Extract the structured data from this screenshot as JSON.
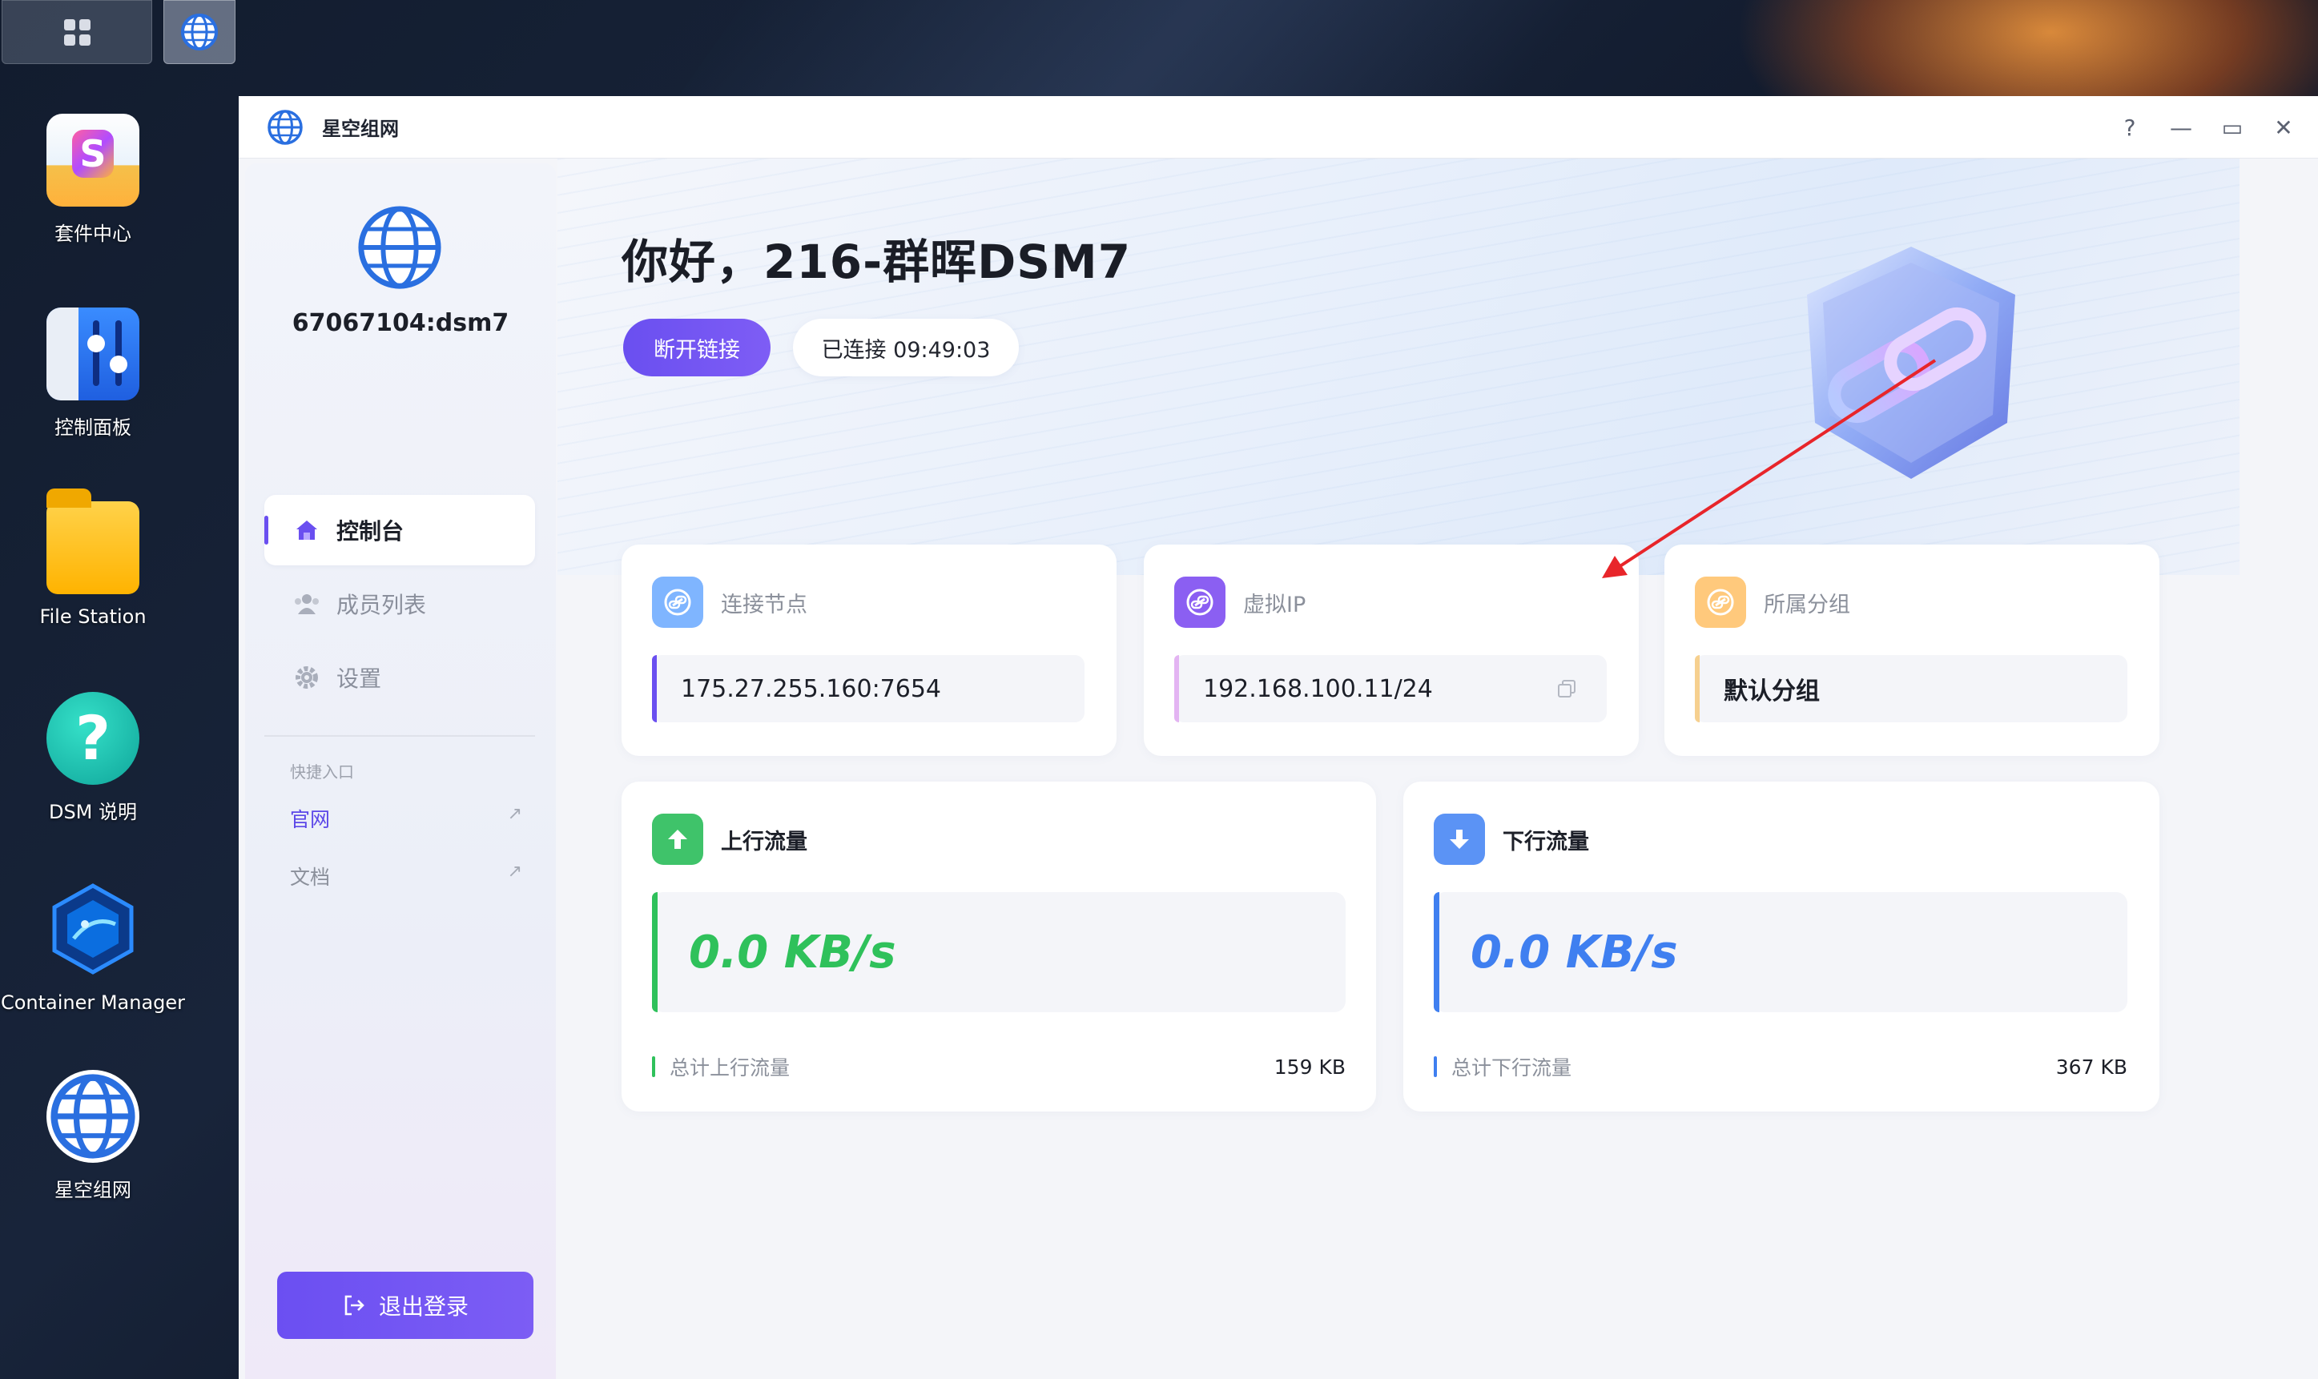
{
  "desktop": {
    "icons": [
      {
        "label": "套件中心"
      },
      {
        "label": "控制面板"
      },
      {
        "label": "File Station"
      },
      {
        "label": "DSM 说明"
      },
      {
        "label": "Container Manager"
      },
      {
        "label": "星空组网"
      }
    ]
  },
  "window": {
    "title": "星空组网",
    "controls": {
      "help": "?",
      "minimize": "—",
      "maximize": "▭",
      "close": "✕"
    }
  },
  "sidebar": {
    "account": "67067104:dsm7",
    "nav": [
      {
        "label": "控制台",
        "icon": "home-icon",
        "active": true
      },
      {
        "label": "成员列表",
        "icon": "members-icon",
        "active": false
      },
      {
        "label": "设置",
        "icon": "gear-icon",
        "active": false
      }
    ],
    "quick_title": "快捷入口",
    "quick_links": [
      {
        "label": "官网",
        "arrow": "↗",
        "color": "#5b47e8"
      },
      {
        "label": "文档",
        "arrow": "↗",
        "color": "#8b909b"
      }
    ],
    "logout_label": "退出登录"
  },
  "main": {
    "greeting": "你好，216-群晖DSM7",
    "disconnect_label": "断开链接",
    "connected_status": "已连接 09:49:03",
    "cards": {
      "node": {
        "label": "连接节点",
        "value": "175.27.255.160:7654",
        "accent": "#6a4ff0"
      },
      "vip": {
        "label": "虚拟IP",
        "value": "192.168.100.11/24",
        "accent": "#e3b4f2"
      },
      "group": {
        "label": "所属分组",
        "value": "默认分组",
        "accent": "#f6d08f"
      }
    },
    "upload": {
      "label": "上行流量",
      "speed": "0.0 KB/s",
      "total_label": "总计上行流量",
      "total_value": "159 KB",
      "color": "#2fc15b"
    },
    "download": {
      "label": "下行流量",
      "speed": "0.0 KB/s",
      "total_label": "总计下行流量",
      "total_value": "367 KB",
      "color": "#3f7ff0"
    }
  },
  "colors": {
    "brand": "#6a4ff0",
    "upload": "#2fc15b",
    "download": "#3f7ff0",
    "annotation": "#e8252a"
  }
}
